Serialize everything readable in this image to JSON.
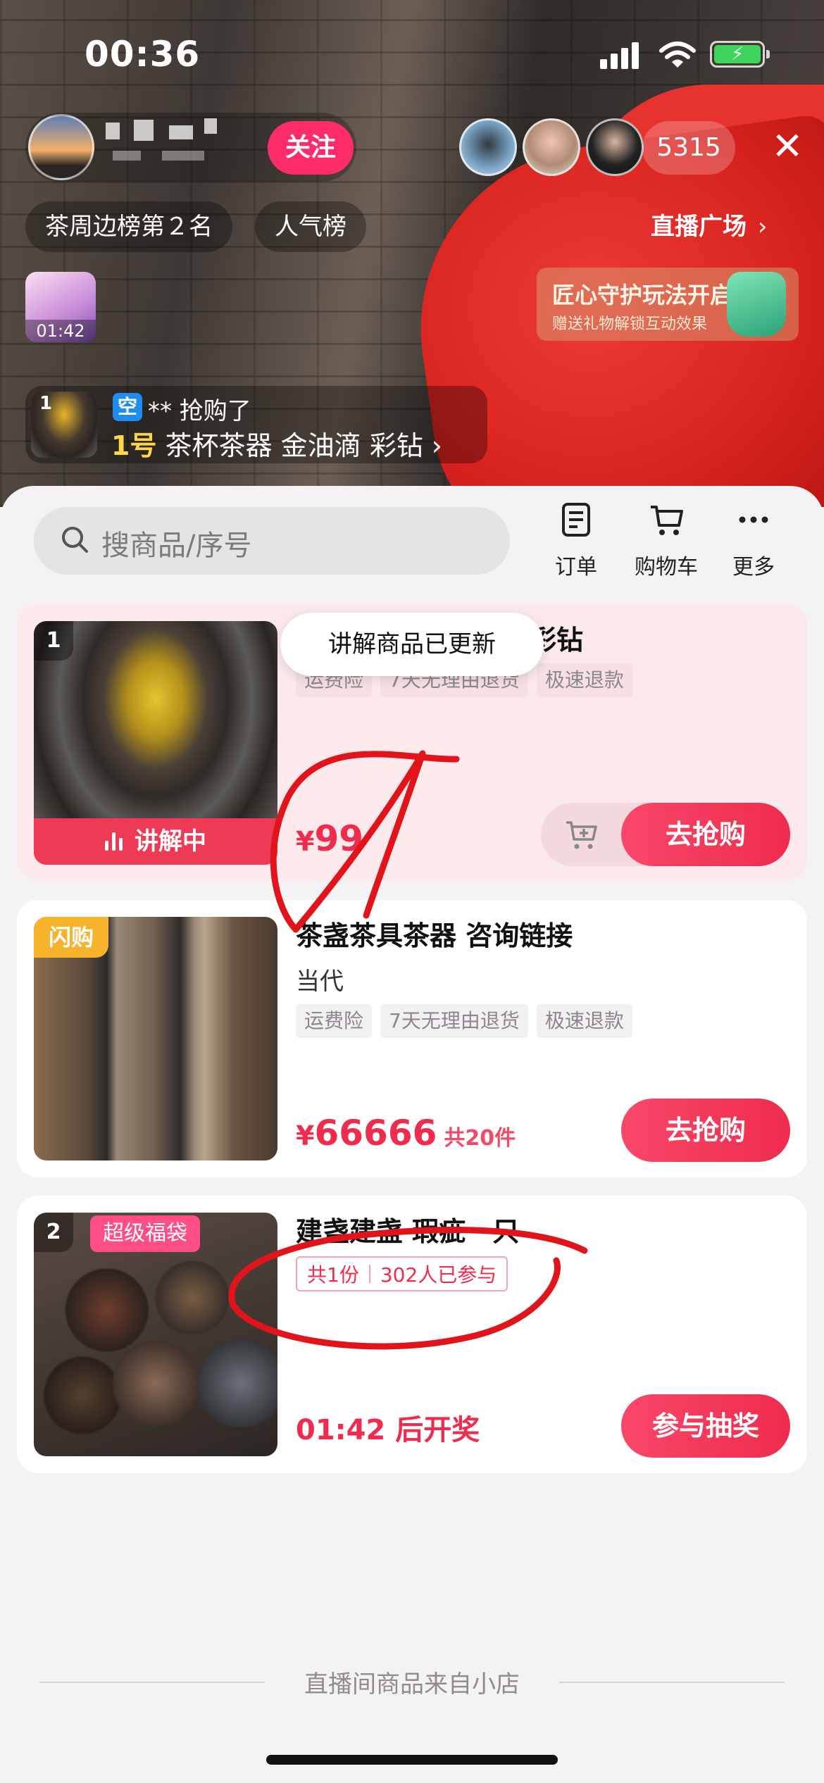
{
  "status_bar": {
    "time": "00:36"
  },
  "live": {
    "follow_label": "关注",
    "viewer_count": "5315",
    "close_label": "✕",
    "rank_label": "茶周边榜第２名",
    "popularity_label": "人气榜",
    "plaza_label": "直播广场",
    "gift_timer": "01:42",
    "banner_title": "匠心守护玩法开启",
    "banner_subtitle": "赠送礼物解锁互动效果",
    "purchase_notice": {
      "index": "1",
      "user_badge": "空",
      "user_text": "** 抢购了",
      "item_number": "1号",
      "item_name": "茶杯茶器 金油滴 彩钻 ›"
    }
  },
  "shop": {
    "search_placeholder": "搜商品/序号",
    "actions": [
      {
        "label": "订单",
        "icon": "order-icon"
      },
      {
        "label": "购物车",
        "icon": "cart-icon"
      },
      {
        "label": "更多",
        "icon": "more-icon"
      }
    ],
    "tooltip": "讲解商品已更新",
    "products": [
      {
        "index": "1",
        "title_visible": "彩钻",
        "tags": [
          "运费险",
          "7天无理由退货",
          "极速退款"
        ],
        "price_symbol": "¥",
        "price": "99",
        "live_label": "讲解中",
        "buy_label": "去抢购"
      },
      {
        "badge": "闪购",
        "title": "茶盏茶具茶器 咨询链接",
        "subtitle": "当代",
        "tags": [
          "运费险",
          "7天无理由退货",
          "极速退款"
        ],
        "price_symbol": "¥",
        "price": "66666",
        "stock": "共20件",
        "buy_label": "去抢购"
      },
      {
        "index": "2",
        "badge": "超级福袋",
        "title": "建盏建盏 瑕疵一只",
        "lottery_total": "共1份",
        "lottery_participants": "302人已参与",
        "countdown": "01:42 后开奖",
        "action_label": "参与抽奖"
      }
    ],
    "footer": "直播间商品来自小店"
  },
  "colors": {
    "accent": "#ef2c4d",
    "follow": "#fe2c6a",
    "flash_badge": "#f7b32b",
    "fu_badge": "#ff4d86"
  }
}
